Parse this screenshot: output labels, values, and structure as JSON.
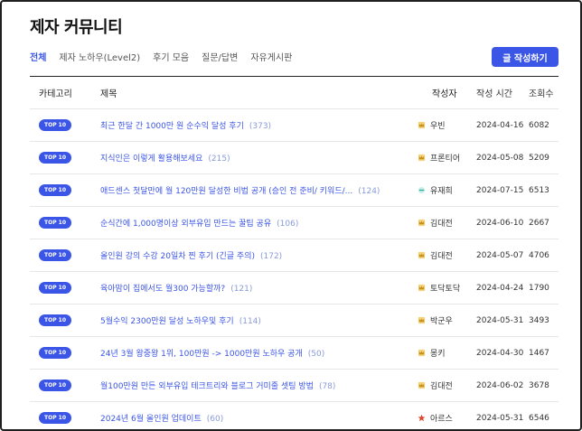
{
  "page": {
    "title": "제자 커뮤니티"
  },
  "tabs": [
    {
      "label": "전체",
      "active": true
    },
    {
      "label": "제자 노하우(Level2)",
      "active": false
    },
    {
      "label": "후기 모음",
      "active": false
    },
    {
      "label": "질문/답변",
      "active": false
    },
    {
      "label": "자유게시판",
      "active": false
    }
  ],
  "write_button": {
    "label": "글 작성하기"
  },
  "table": {
    "headers": {
      "category": "카테고리",
      "title": "제목",
      "author": "작성자",
      "date": "작성 시간",
      "views": "조회수"
    },
    "rows": [
      {
        "badge": "TOP 10",
        "title": "최근 한달 간 1000만 원 순수익 달성 후기",
        "comments": "(373)",
        "author_icon": "crown-icon",
        "author": "우빈",
        "date": "2024-04-16",
        "views": "6082"
      },
      {
        "badge": "TOP 10",
        "title": "지식인은 이렇게 활용해보세요",
        "comments": "(215)",
        "author_icon": "crown-icon",
        "author": "프론티어",
        "date": "2024-05-08",
        "views": "5209"
      },
      {
        "badge": "TOP 10",
        "title": "애드센스 첫달만에 월 120만원 달성한 비법 공개 (승인 전 준비/ 키워드/...",
        "comments": "(124)",
        "author_icon": "diamond-icon",
        "author": "유재희",
        "date": "2024-07-15",
        "views": "6513"
      },
      {
        "badge": "TOP 10",
        "title": "순식간에 1,000명이상 외부유입 만드는 꿀팁 공유",
        "comments": "(106)",
        "author_icon": "crown-icon",
        "author": "김대전",
        "date": "2024-06-10",
        "views": "2667"
      },
      {
        "badge": "TOP 10",
        "title": "올인원 강의 수강 20일차 찐 후기 (긴글 주의)",
        "comments": "(172)",
        "author_icon": "crown-icon",
        "author": "김대전",
        "date": "2024-05-07",
        "views": "4706"
      },
      {
        "badge": "TOP 10",
        "title": "육아맘이 집에서도 월300 가능할까?",
        "comments": "(121)",
        "author_icon": "crown-icon",
        "author": "토닥토닥",
        "date": "2024-04-24",
        "views": "1790"
      },
      {
        "badge": "TOP 10",
        "title": "5월수익 2300만원 달성 노하우및 후기",
        "comments": "(114)",
        "author_icon": "crown-icon",
        "author": "박군우",
        "date": "2024-05-31",
        "views": "3493"
      },
      {
        "badge": "TOP 10",
        "title": "24년 3월 왕중왕 1위, 100만원 -> 1000만원 노하우 공개",
        "comments": "(50)",
        "author_icon": "crown-icon",
        "author": "몽키",
        "date": "2024-04-30",
        "views": "1467"
      },
      {
        "badge": "TOP 10",
        "title": "월100만원 만든 외부유입 테크트리와 블로그 거미줄 셋팅 방법",
        "comments": "(78)",
        "author_icon": "crown-icon",
        "author": "김대전",
        "date": "2024-06-02",
        "views": "3678"
      },
      {
        "badge": "TOP 10",
        "title": "2024년 6월 올인원 업데이트",
        "comments": "(60)",
        "author_icon": "star-icon",
        "author": "아르스",
        "date": "2024-05-31",
        "views": "6546"
      }
    ]
  },
  "colors": {
    "accent": "#3b55e6",
    "comment_count": "#8a9ad8",
    "crown": "#e0a81a",
    "star": "#d9472b",
    "diamond": "#2fb5a8"
  }
}
